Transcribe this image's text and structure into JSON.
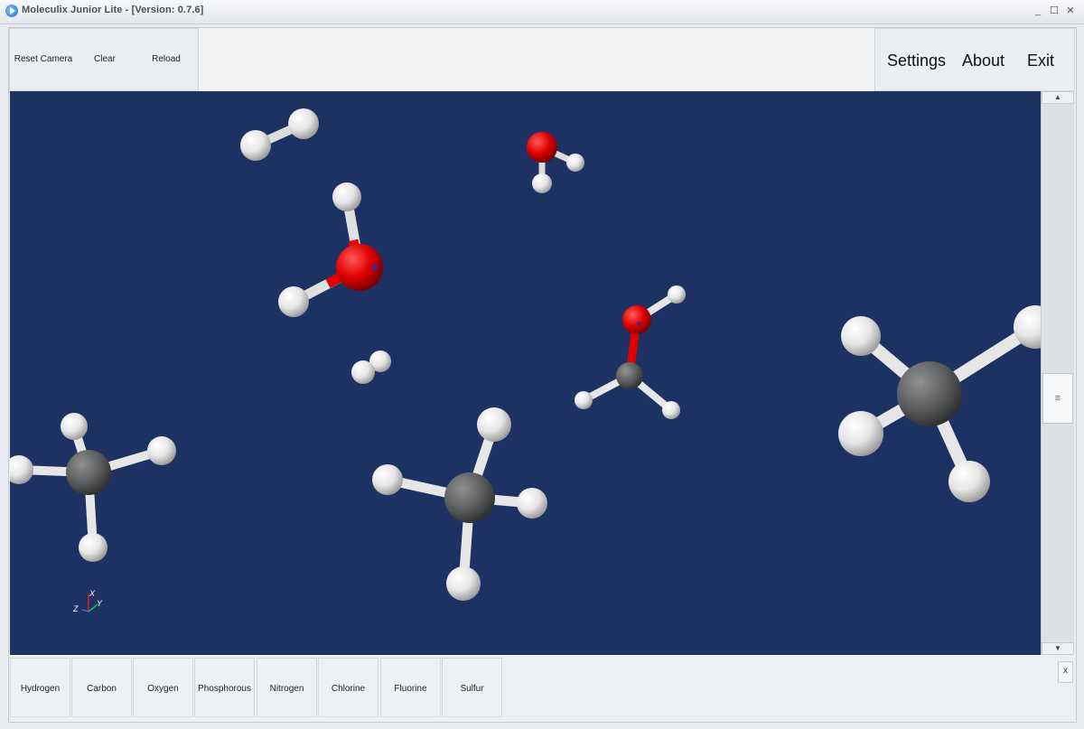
{
  "window": {
    "title": "Moleculix Junior Lite - [Version: 0.7.6]",
    "minimize_glyph": "_",
    "maximize_glyph": "☐",
    "close_glyph": "✕"
  },
  "toolbar": {
    "reset_camera": "Reset Camera",
    "clear": "Clear",
    "reload": "Reload"
  },
  "menu": {
    "settings": "Settings",
    "about": "About",
    "exit": "Exit"
  },
  "axis_triad": {
    "x": "X",
    "y": "Y",
    "z": "Z"
  },
  "scrollbar": {
    "up_glyph": "▲",
    "down_glyph": "▼",
    "thumb_glyph": "≡"
  },
  "elements": {
    "hydrogen": "Hydrogen",
    "carbon": "Carbon",
    "oxygen": "Oxygen",
    "phosphorous": "Phosphorous",
    "nitrogen": "Nitrogen",
    "chlorine": "Chlorine",
    "fluorine": "Fluorine",
    "sulfur": "Sulfur"
  },
  "panel_close": "x",
  "colors": {
    "viewport_bg": "#1d3263",
    "hydrogen_atom": "#f2f2f2",
    "carbon_atom": "#5a5c5e",
    "oxygen_atom": "#e00000"
  }
}
